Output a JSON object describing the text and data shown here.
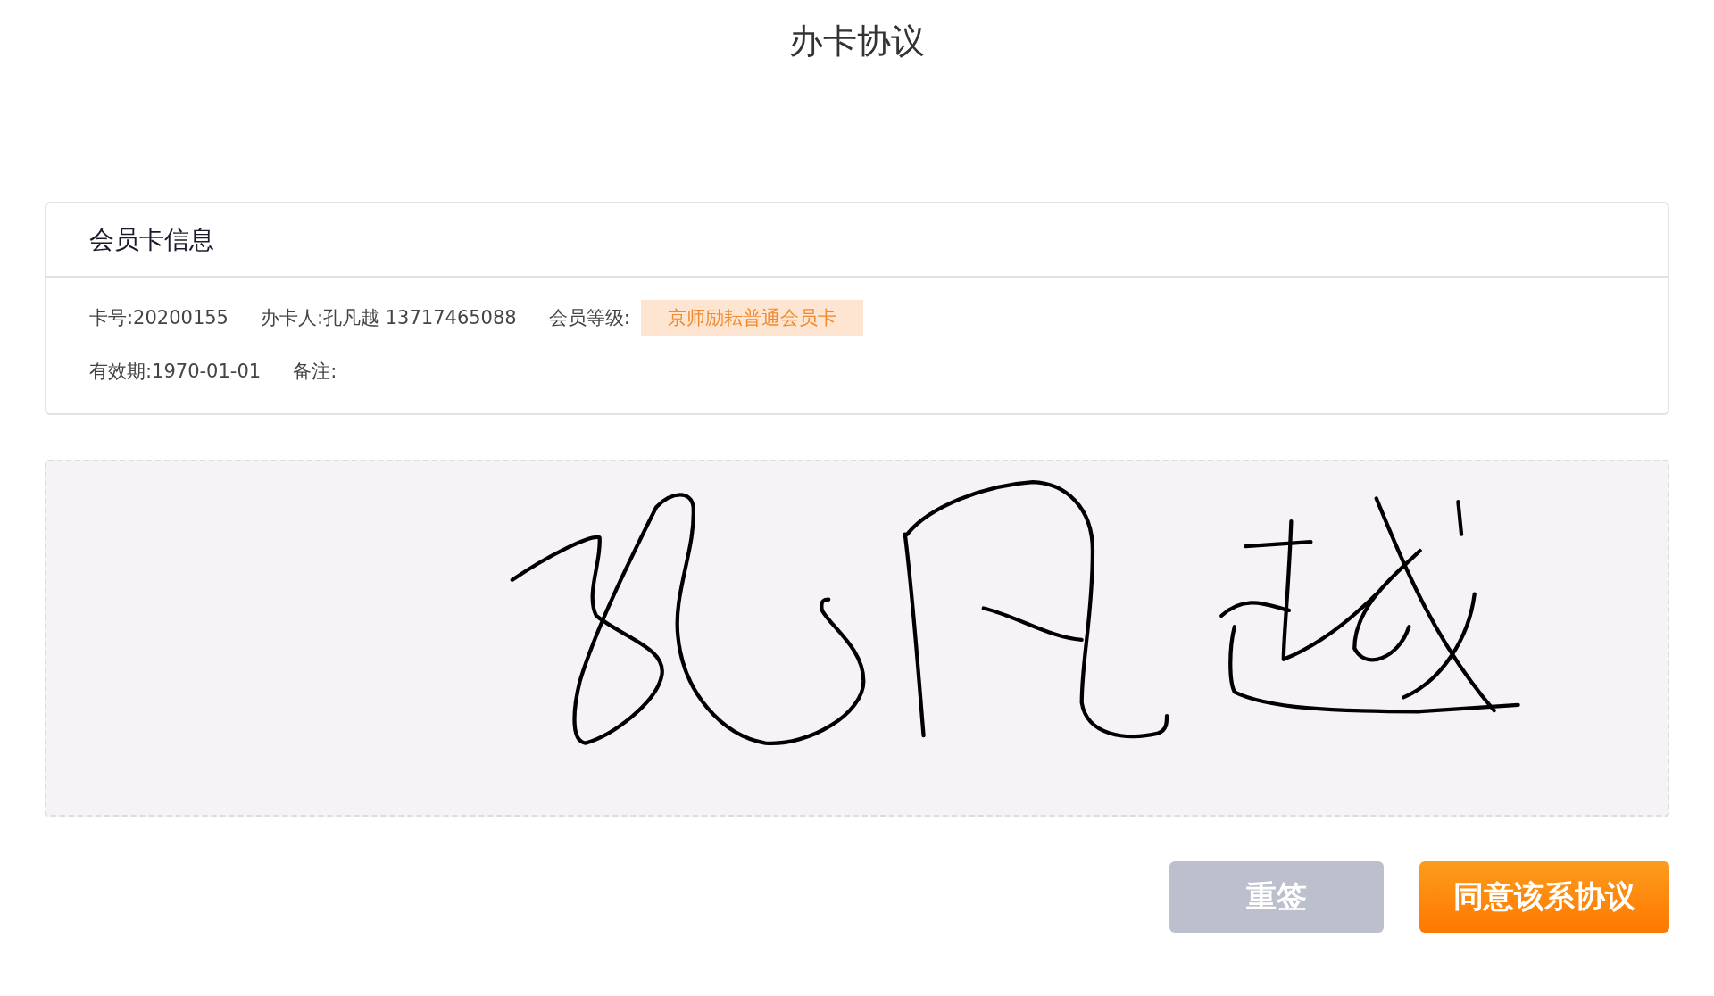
{
  "title": "办卡协议",
  "card": {
    "heading": "会员卡信息",
    "rows": [
      [
        {
          "kind": "text",
          "text": "卡号:20200155"
        },
        {
          "kind": "text",
          "text": "办卡人:孔凡越 13717465088"
        },
        {
          "kind": "tag",
          "label": "会员等级:",
          "value": "京师励耘普通会员卡"
        }
      ],
      [
        {
          "kind": "text",
          "text": "有效期:1970-01-01"
        },
        {
          "kind": "text",
          "text": "备注:"
        }
      ]
    ]
  },
  "buttons": [
    {
      "label": "重签",
      "kind": "secondary"
    },
    {
      "label": "同意该系协议",
      "kind": "primary"
    }
  ]
}
